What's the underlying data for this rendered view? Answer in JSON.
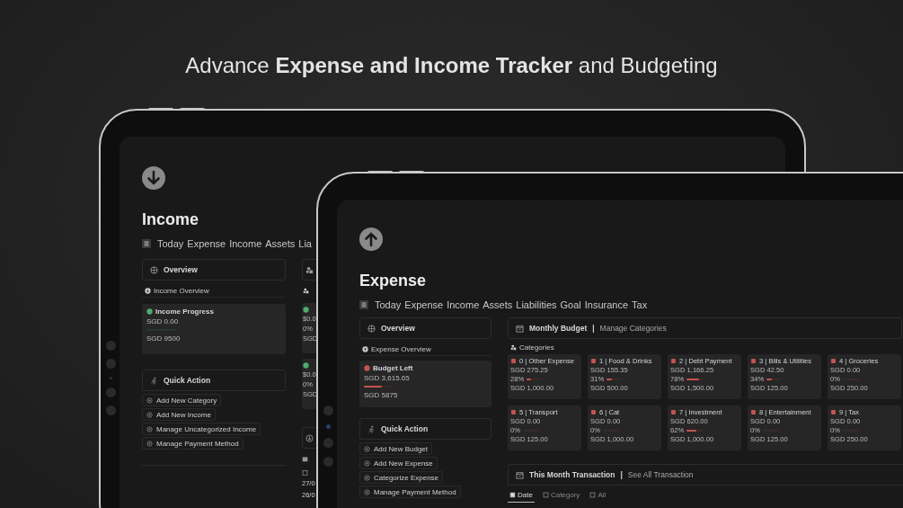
{
  "headline": "Advance **Expense and Income Tracker** and Budgeting",
  "back_screen": {
    "title": "Income",
    "tabs": [
      "Today",
      "Expense",
      "Income",
      "Assets",
      "Lia"
    ],
    "overview": "Overview",
    "subheading": "Income Overview",
    "progress": {
      "title": "Income Progress",
      "amount": "SGD 0.00",
      "level": 0,
      "target": "SGD 9500"
    },
    "quick_action": {
      "title": "Quick Action",
      "buttons": [
        "Add New Category",
        "Add New Income",
        "Manage Uncategorized Income",
        "Manage Payment Method"
      ]
    },
    "side_cards": [
      {
        "lines": [
          "$0.0",
          "0%",
          "SGD"
        ]
      },
      {
        "lines": [
          "$0.0",
          "0%",
          "SGD"
        ]
      }
    ],
    "dates": [
      "27/0",
      "26/0"
    ]
  },
  "front_screen": {
    "title": "Expense",
    "tabs": [
      "Today",
      "Expense",
      "Income",
      "Assets",
      "Liabilities",
      "Goal",
      "Insurance",
      "Tax"
    ],
    "overview": "Overview",
    "subheading": "Expense Overview",
    "budget_left": {
      "title": "Budget Left",
      "amount": "SGD 3,615.65",
      "level": 0.62,
      "target": "SGD 5875"
    },
    "quick_action": {
      "title": "Quick Action",
      "buttons": [
        "Add New Budget",
        "Add New Expense",
        "Categorize Expense",
        "Manage Payment Method"
      ]
    },
    "monthly_budget": {
      "title": "Monthly Budget",
      "separator": "|",
      "link": "Manage Categories"
    },
    "categories_heading": "Categories",
    "categories": [
      {
        "name": "0 | Other Expense",
        "spent": "SGD 275.25",
        "percent": "28%",
        "level": 0.28,
        "budget": "SGD 1,000.00"
      },
      {
        "name": "1 | Food & Drinks",
        "spent": "SGD 155.35",
        "percent": "31%",
        "level": 0.31,
        "budget": "SGD 500.00"
      },
      {
        "name": "2 | Debt Payment",
        "spent": "SGD 1,166.25",
        "percent": "78%",
        "level": 0.78,
        "budget": "SGD 1,500.00"
      },
      {
        "name": "3 | Bills & Utilities",
        "spent": "SGD 42.50",
        "percent": "34%",
        "level": 0.34,
        "budget": "SGD 125.00"
      },
      {
        "name": "4 | Groceries",
        "spent": "SGD 0.00",
        "percent": "0%",
        "level": 0,
        "budget": "SGD 250.00"
      },
      {
        "name": "5 | Transport",
        "spent": "SGD 0.00",
        "percent": "0%",
        "level": 0,
        "budget": "SGD 125.00"
      },
      {
        "name": "6 | Cat",
        "spent": "SGD 0.00",
        "percent": "0%",
        "level": 0,
        "budget": "SGD 1,000.00"
      },
      {
        "name": "7 | Investment",
        "spent": "SGD 620.00",
        "percent": "62%",
        "level": 0.62,
        "budget": "SGD 1,000.00"
      },
      {
        "name": "8 | Entertainment",
        "spent": "SGD 0.00",
        "percent": "0%",
        "level": 0,
        "budget": "SGD 125.00"
      },
      {
        "name": "9 | Tax",
        "spent": "SGD 0.00",
        "percent": "0%",
        "level": 0,
        "budget": "SGD 250.00"
      }
    ],
    "transactions": {
      "title": "This Month Transaction",
      "separator": "|",
      "link": "See All Transaction",
      "views": [
        {
          "label": "Date",
          "selected": true
        },
        {
          "label": "Category",
          "selected": false
        },
        {
          "label": "All",
          "selected": false
        }
      ]
    }
  }
}
